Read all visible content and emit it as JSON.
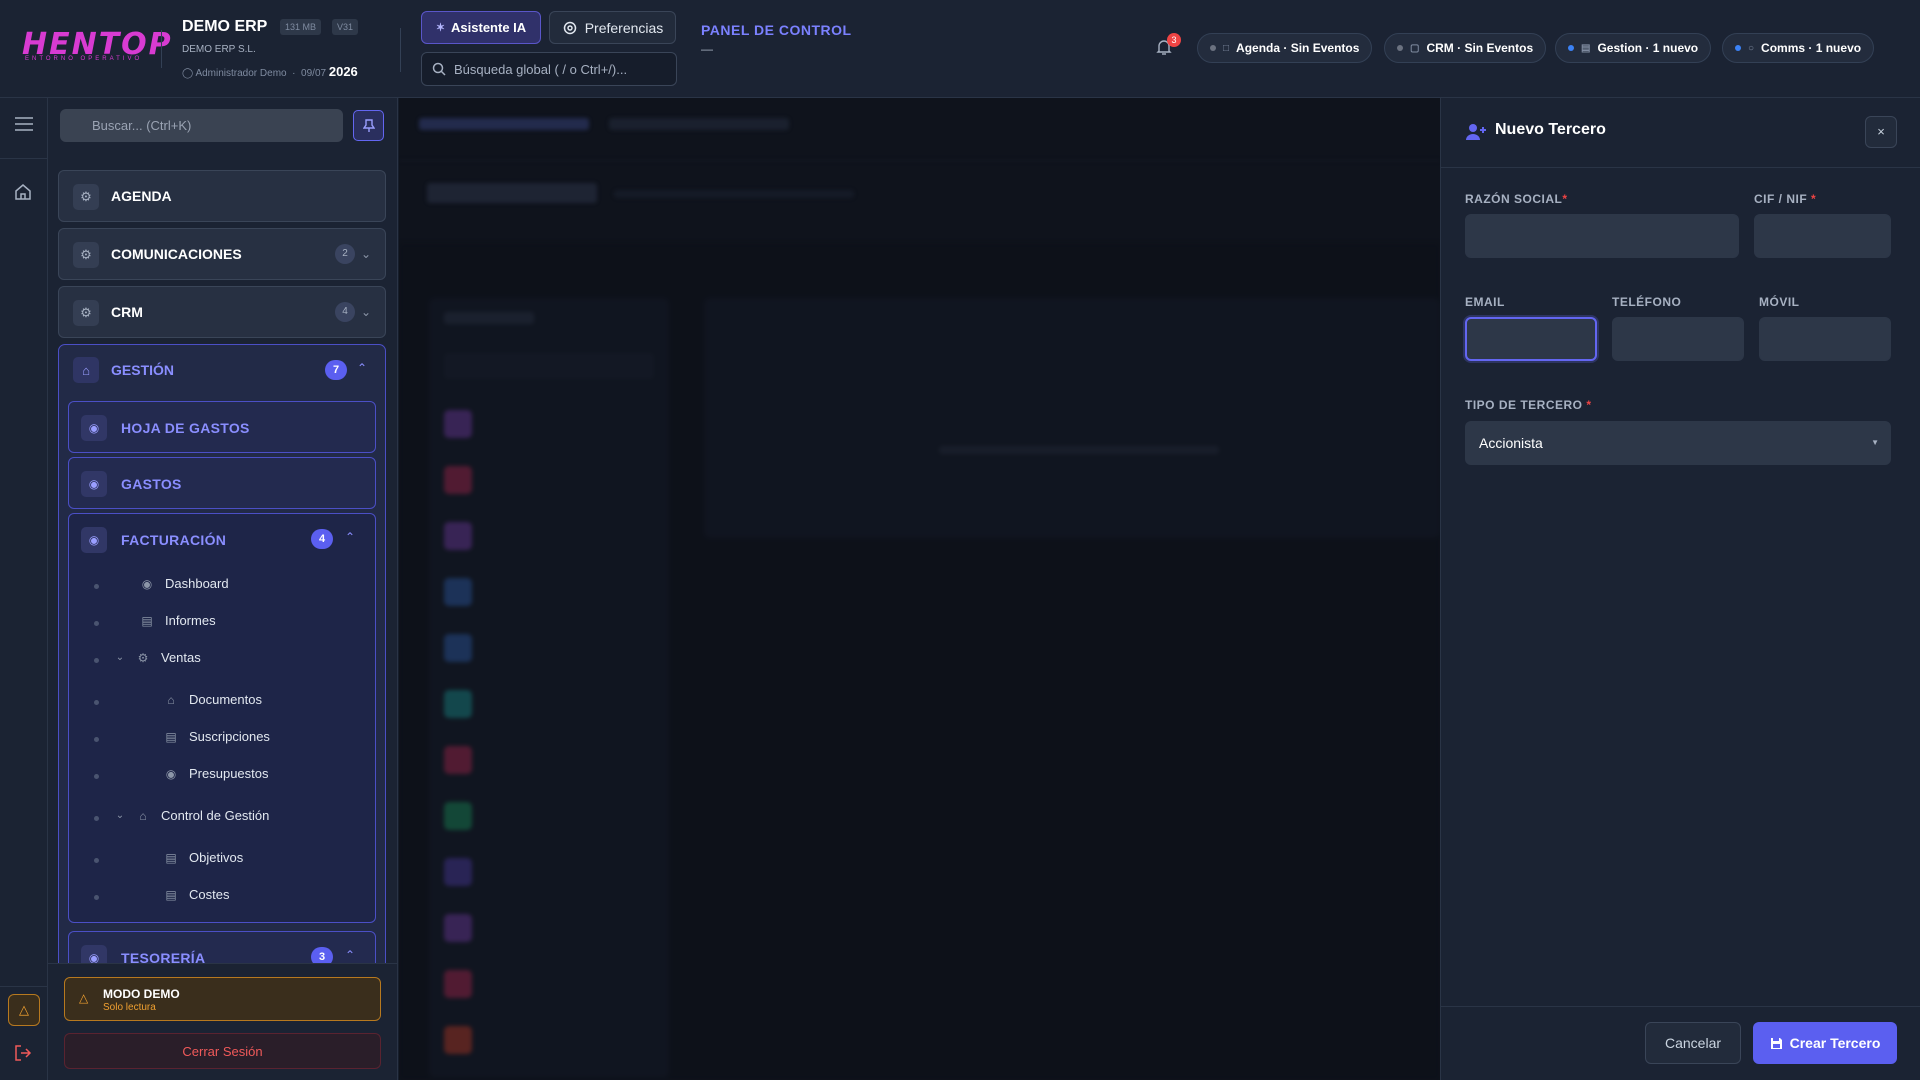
{
  "header": {
    "logo_text": "HENTOP",
    "logo_sub": "ENTORNO OPERATIVO",
    "company_title": "DEMO ERP",
    "memory_tag": "131 MB",
    "version_tag": "V31",
    "company_name": "DEMO ERP S.L.",
    "user": "Administrador Demo",
    "date": "09/07",
    "year": "2026",
    "ai_button": "Asistente IA",
    "prefs_button": "Preferencias",
    "search_placeholder": "Búsqueda global ( / o Ctrl+/)...",
    "panel_title": "PANEL DE CONTROL",
    "panel_sub": "—",
    "notif_count": "3",
    "pills": [
      {
        "label": "Agenda · Sin Eventos",
        "dot": "#6b7280",
        "icon": "calendar-icon"
      },
      {
        "label": "CRM · Sin Eventos",
        "dot": "#6b7280",
        "icon": "crm-icon"
      },
      {
        "label": "Gestion · 1 nuevo",
        "dot": "#3b82f6",
        "icon": "document-icon"
      },
      {
        "label": "Comms · 1 nuevo",
        "dot": "#3b82f6",
        "icon": "chat-icon"
      }
    ]
  },
  "sidebar": {
    "search_placeholder": "Buscar... (Ctrl+K)",
    "modules": [
      {
        "label": "AGENDA",
        "badge": ""
      },
      {
        "label": "COMUNICACIONES",
        "badge": "2"
      },
      {
        "label": "CRM",
        "badge": "4"
      }
    ],
    "gestion": {
      "label": "GESTIÓN",
      "badge": "7",
      "hoja_gastos": "HOJA DE GASTOS",
      "gastos": "GASTOS",
      "facturacion": {
        "label": "FACTURACIÓN",
        "badge": "4",
        "items": {
          "dashboard": "Dashboard",
          "informes": "Informes",
          "ventas": "Ventas",
          "documentos": "Documentos",
          "suscripciones": "Suscripciones",
          "presupuestos": "Presupuestos",
          "control": "Control de Gestión",
          "objetivos": "Objetivos",
          "costes": "Costes"
        }
      },
      "tesoreria": {
        "label": "TESORERÍA",
        "badge": "3"
      }
    },
    "demo_title": "MODO DEMO",
    "demo_sub": "Solo lectura",
    "logout": "Cerrar Sesión"
  },
  "drawer": {
    "title": "Nuevo Tercero",
    "close": "×",
    "fields": {
      "razon_social": "RAZÓN SOCIAL",
      "cif": "CIF / NIF",
      "email": "EMAIL",
      "telefono": "TELÉFONO",
      "movil": "MÓVIL",
      "tipo": "TIPO DE TERCERO"
    },
    "required_mark": "*",
    "tipo_value": "Accionista",
    "cancel": "Cancelar",
    "create": "Crear Tercero"
  },
  "colors": {
    "accent": "#5b5ff0",
    "brand": "#d83bd2",
    "danger": "#ef4444",
    "warning": "#f0a030"
  }
}
